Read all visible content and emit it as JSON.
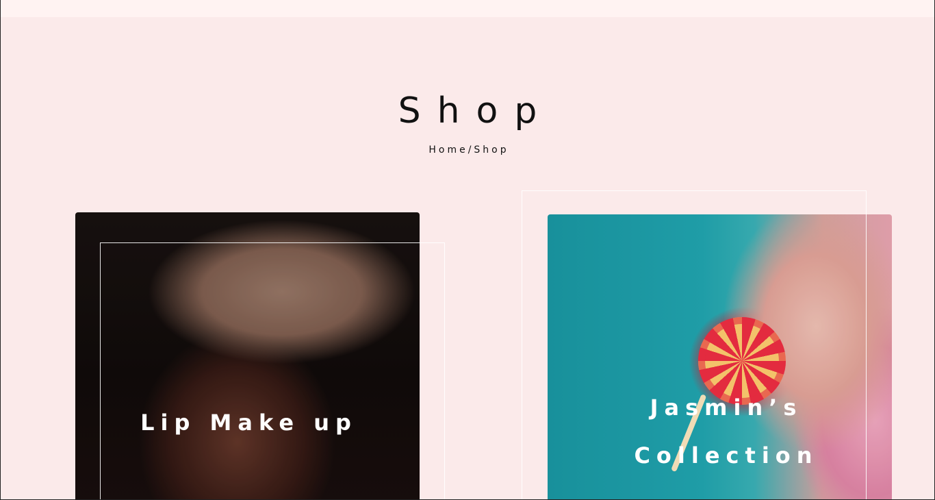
{
  "page": {
    "title": "Shop"
  },
  "breadcrumb": {
    "home": "Home",
    "separator": "/",
    "current": "Shop"
  },
  "cards": [
    {
      "title": "Lip Make up",
      "image": "woman-in-straw-hat-photo"
    },
    {
      "title_line1": "Jasmin’s",
      "title_line2": "Collection",
      "image": "woman-with-pink-hair-and-lollipop-photo"
    }
  ],
  "colors": {
    "page_background": "#fbeaea",
    "top_bar": "#fff3f2",
    "text": "#111111",
    "card_text": "#ffffff"
  }
}
